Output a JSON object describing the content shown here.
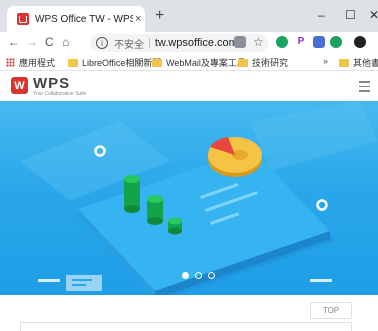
{
  "browser": {
    "tab_title": "WPS Office TW - WPS Office",
    "tab_close": "×",
    "new_tab": "+",
    "window_minimize": "–",
    "window_maximize": "☐",
    "window_close": "✕",
    "nav": {
      "back": "←",
      "forward": "→",
      "reload": "C",
      "home": "⌂"
    },
    "security_label": "不安全",
    "url": "tw.wpsoffice.com",
    "bookmarks": [
      {
        "label": "應用程式"
      },
      {
        "label": "LibreOffice相關新聞"
      },
      {
        "label": "WebMail及專案工具"
      },
      {
        "label": "技術研究"
      },
      {
        "label": "其他書籤"
      }
    ],
    "bookmarks_overflow": "»"
  },
  "site": {
    "logo_text": "WPS",
    "logo_sub": "Your Collaborative Suite",
    "carousel": {
      "slides": 3,
      "active_index": 0
    },
    "top_button": "TOP"
  },
  "colors": {
    "brand_red": "#d9362f",
    "hero_blue": "#2aa7ea"
  }
}
